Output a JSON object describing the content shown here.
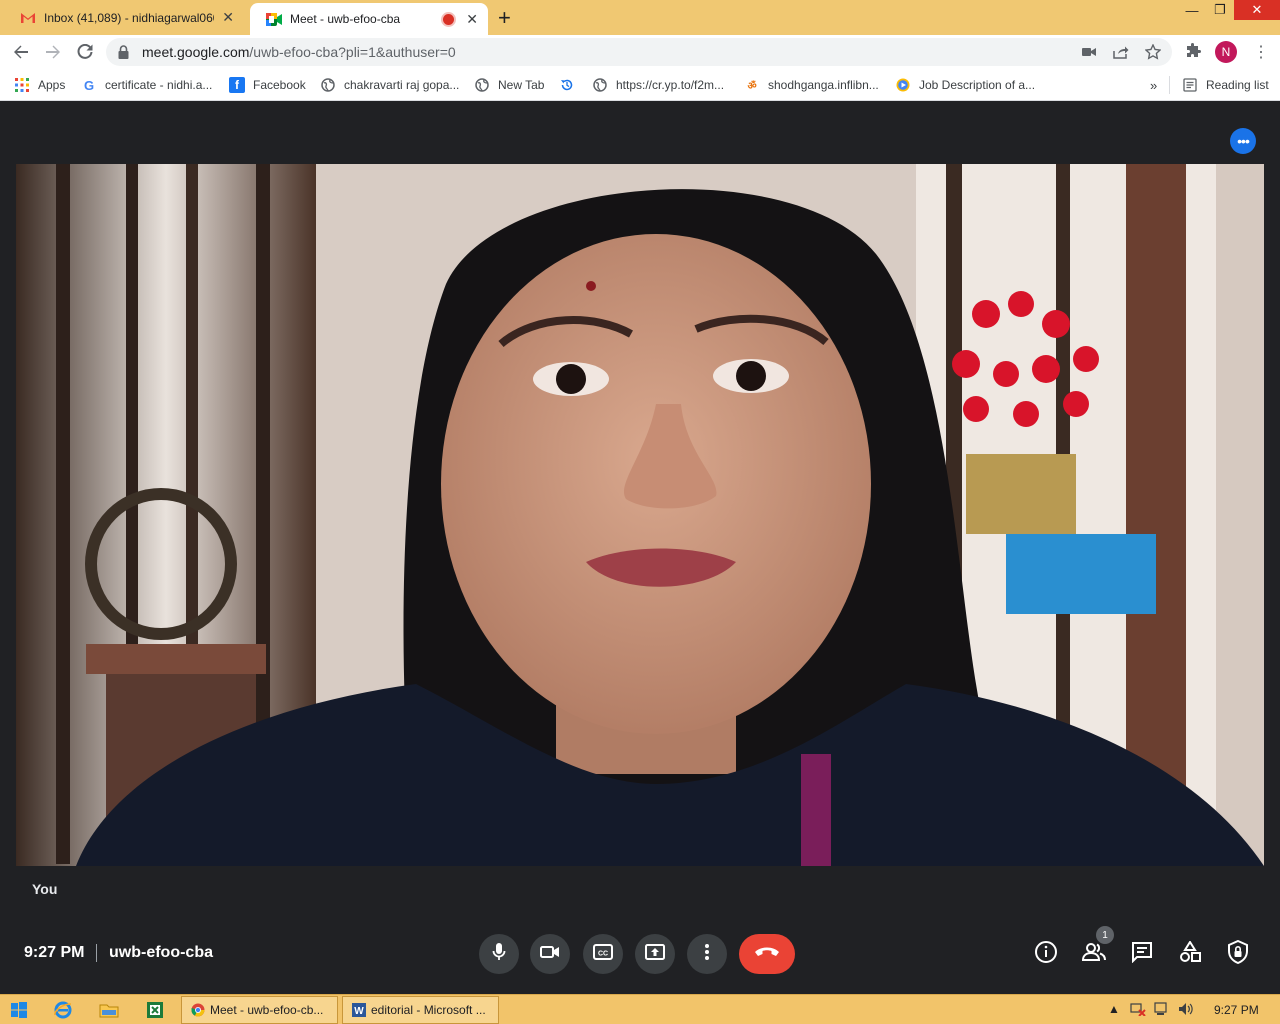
{
  "browser": {
    "tabs": [
      {
        "title": "Inbox (41,089) - nidhiagarwal060",
        "icon": "gmail-icon",
        "active": false
      },
      {
        "title": "Meet - uwb-efoo-cba",
        "icon": "meet-icon",
        "active": true,
        "recording": true
      }
    ],
    "url_host": "meet.google.com",
    "url_path": "/uwb-efoo-cba?pli=1&authuser=0",
    "profile_initial": "N",
    "bookmarks": [
      {
        "label": "Apps",
        "icon": "apps-grid-icon"
      },
      {
        "label": "certificate - nidhi.a...",
        "icon": "google-icon"
      },
      {
        "label": "Facebook",
        "icon": "facebook-icon"
      },
      {
        "label": "chakravarti raj gopa...",
        "icon": "globe-icon"
      },
      {
        "label": "New Tab",
        "icon": "globe-icon"
      },
      {
        "label": "",
        "icon": "history-icon"
      },
      {
        "label": "https://cr.yp.to/f2m...",
        "icon": "globe-icon"
      },
      {
        "label": "shodhganga.inflibn...",
        "icon": "shodhganga-icon"
      },
      {
        "label": "Job Description of a...",
        "icon": "play-icon"
      }
    ],
    "overflow_label": "»",
    "reading_list_label": "Reading list"
  },
  "meet": {
    "self_label": "You",
    "time": "9:27 PM",
    "meeting_code": "uwb-efoo-cba",
    "participants_count": "1"
  },
  "taskbar": {
    "tasks": [
      {
        "label": "Meet - uwb-efoo-cb...",
        "icon": "chrome-icon"
      },
      {
        "label": "editorial - Microsoft ...",
        "icon": "word-icon"
      }
    ],
    "clock": "9:27 PM"
  },
  "colors": {
    "titlebar": "#f0c872",
    "meet_bg": "#202124",
    "end_call": "#ea4335",
    "accent_blue": "#1a73e8",
    "profile": "#c2185b"
  }
}
